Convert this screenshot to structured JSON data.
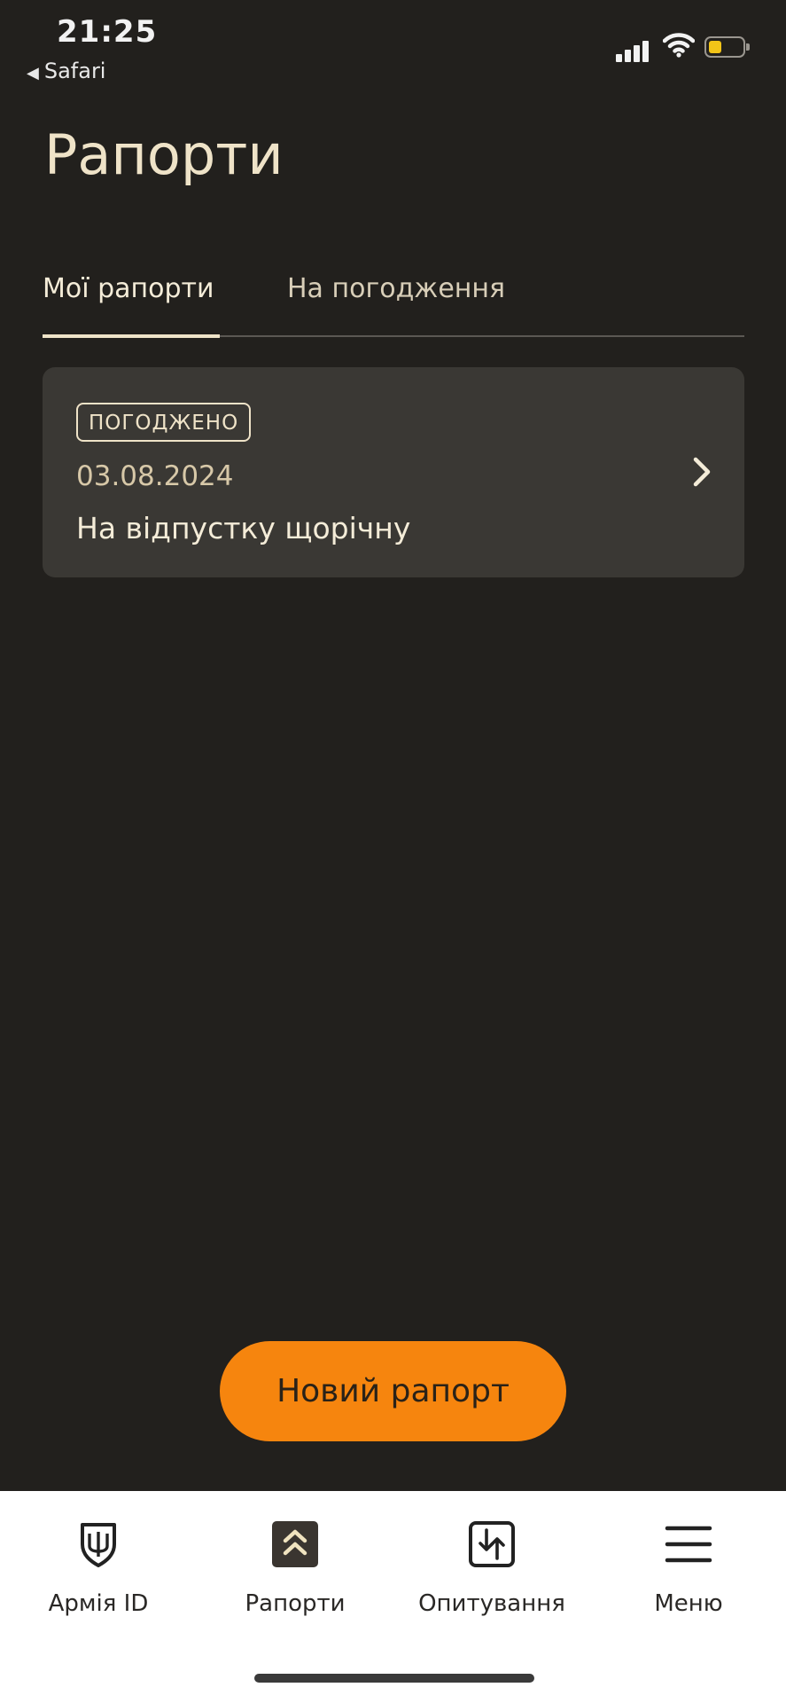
{
  "status_bar": {
    "time": "21:25",
    "back_app": "Safari",
    "icons": [
      "cellular-signal-icon",
      "wifi-icon",
      "battery-icon"
    ]
  },
  "page": {
    "title": "Рапорти"
  },
  "tabs": [
    {
      "label": "Мої рапорти",
      "active": true
    },
    {
      "label": "На погодження",
      "active": false
    }
  ],
  "reports": [
    {
      "status": "ПОГОДЖЕНО",
      "date": "03.08.2024",
      "title": "На відпустку щорічну"
    }
  ],
  "new_report_button": "Новий рапорт",
  "bottom_nav": [
    {
      "label": "Армія ID",
      "icon": "shield-trident-icon"
    },
    {
      "label": "Рапорти",
      "icon": "chevrons-up-icon",
      "active": true
    },
    {
      "label": "Опитування",
      "icon": "survey-arrows-icon"
    },
    {
      "label": "Меню",
      "icon": "hamburger-menu-icon"
    }
  ],
  "colors": {
    "background": "#22201d",
    "card": "#3a3834",
    "accent": "#f6850e",
    "title_text": "#efe3c8",
    "tabbar": "#ffffff"
  }
}
